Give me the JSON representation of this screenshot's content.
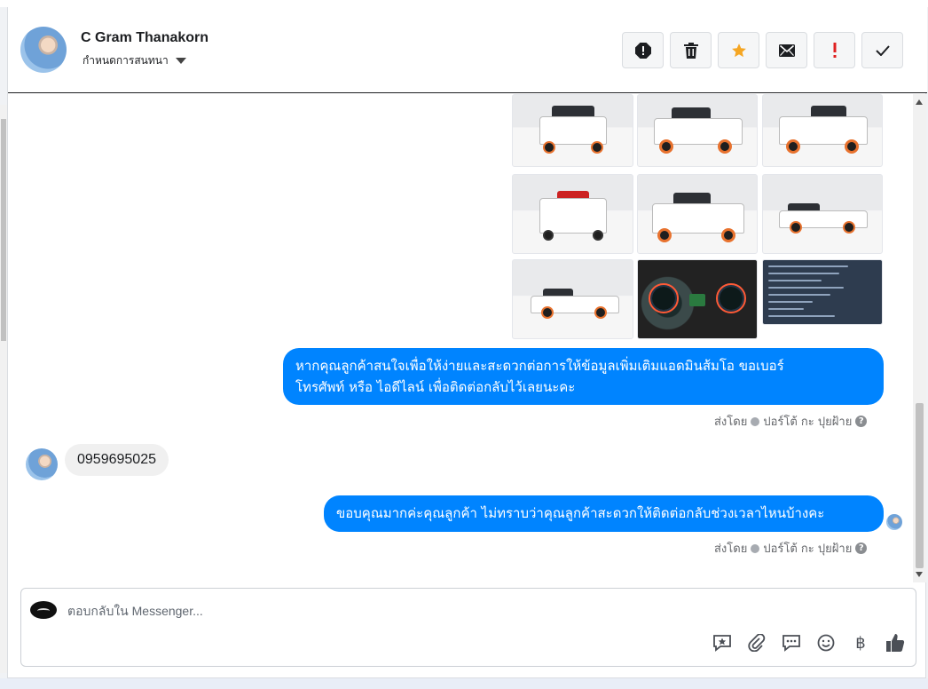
{
  "header": {
    "contact_name": "C Gram Thanakorn",
    "conversation_menu": "กำหนดการสนทนา",
    "actions": [
      {
        "name": "spam-button",
        "icon": "octagon-alert-icon"
      },
      {
        "name": "delete-button",
        "icon": "trash-icon"
      },
      {
        "name": "star-button",
        "icon": "star-icon",
        "color": "#f5a623"
      },
      {
        "name": "mark-unread-button",
        "icon": "envelope-icon"
      },
      {
        "name": "follow-up-button",
        "icon": "exclamation-icon",
        "color": "#e02020"
      },
      {
        "name": "done-button",
        "icon": "check-icon"
      }
    ]
  },
  "messages": [
    {
      "type": "photo-grid",
      "direction": "outgoing",
      "photos": [
        "truck-front",
        "truck-front-angle",
        "truck-rear-angle",
        "truck-rear",
        "truck-rear-angle-2",
        "truck-side",
        "truck-side-2",
        "dashboard",
        "info-card"
      ]
    },
    {
      "type": "text",
      "direction": "outgoing",
      "lines": [
        "หากคุณลูกค้าสนใจเพื่อให้ง่ายและสะดวกต่อการให้ข้อมูลเพิ่มเติมแอดมินส้มโอ ขอเบอร์",
        "โทรศัพท์ หรือ ไอดีไลน์ เพื่อติดต่อกลับไว้เลยนะคะ"
      ],
      "sent_by_prefix": "ส่งโดย",
      "sent_by_name": "ปอร์โต้ กะ ปุยฝ้าย"
    },
    {
      "type": "text",
      "direction": "incoming",
      "text": "0959695025"
    },
    {
      "type": "text",
      "direction": "outgoing",
      "text": "ขอบคุณมากค่ะคุณลูกค้า ไม่ทราบว่าคุณลูกค้าสะดวกให้ติดต่อกลับช่วงเวลาไหนบ้างคะ",
      "sent_by_prefix": "ส่งโดย",
      "sent_by_name": "ปอร์โต้ กะ ปุยฝ้าย"
    }
  ],
  "composer": {
    "placeholder": "ตอบกลับใน Messenger...",
    "tools": [
      "saved-reply-icon",
      "attachment-icon",
      "chat-bubble-icon",
      "emoji-icon",
      "baht-icon",
      "thumbs-up-icon"
    ],
    "baht_symbol": "฿"
  },
  "colors": {
    "outgoing_bubble": "#0084ff",
    "incoming_bubble": "#f0f0f0",
    "star": "#f5a623",
    "alert": "#e02020"
  }
}
